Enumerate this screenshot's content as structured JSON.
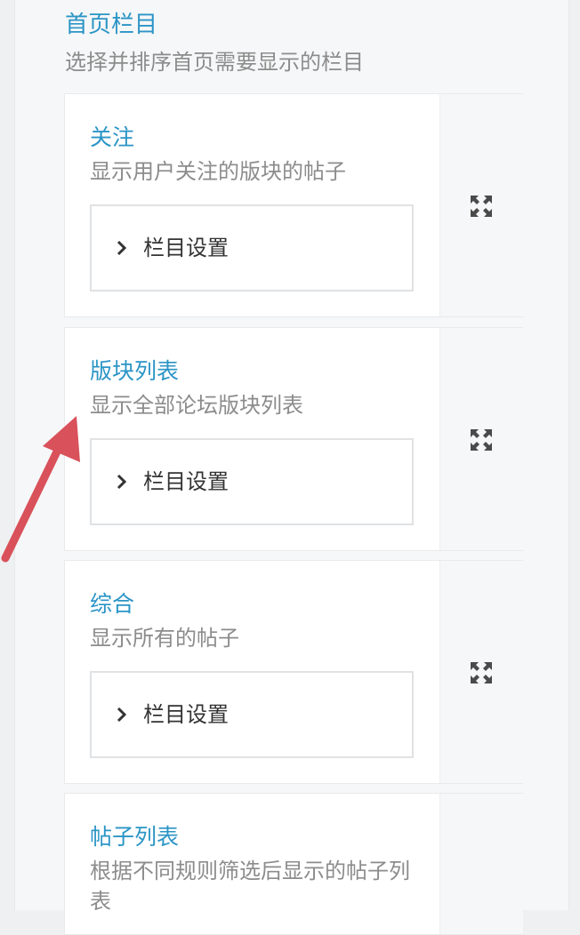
{
  "section": {
    "title": "首页栏目",
    "description": "选择并排序首页需要显示的栏目"
  },
  "items": [
    {
      "title": "关注",
      "description": "显示用户关注的版块的帖子",
      "settings_label": "栏目设置"
    },
    {
      "title": "版块列表",
      "description": "显示全部论坛版块列表",
      "settings_label": "栏目设置"
    },
    {
      "title": "综合",
      "description": "显示所有的帖子",
      "settings_label": "栏目设置"
    },
    {
      "title": "帖子列表",
      "description": "根据不同规则筛选后显示的帖子列表"
    }
  ],
  "colors": {
    "accent": "#2b95c6",
    "muted_text": "#8c8c8c",
    "annotation_arrow": "#d9515a"
  },
  "icons": {
    "move": "move-arrows-icon",
    "chevron": "chevron-right-icon"
  }
}
